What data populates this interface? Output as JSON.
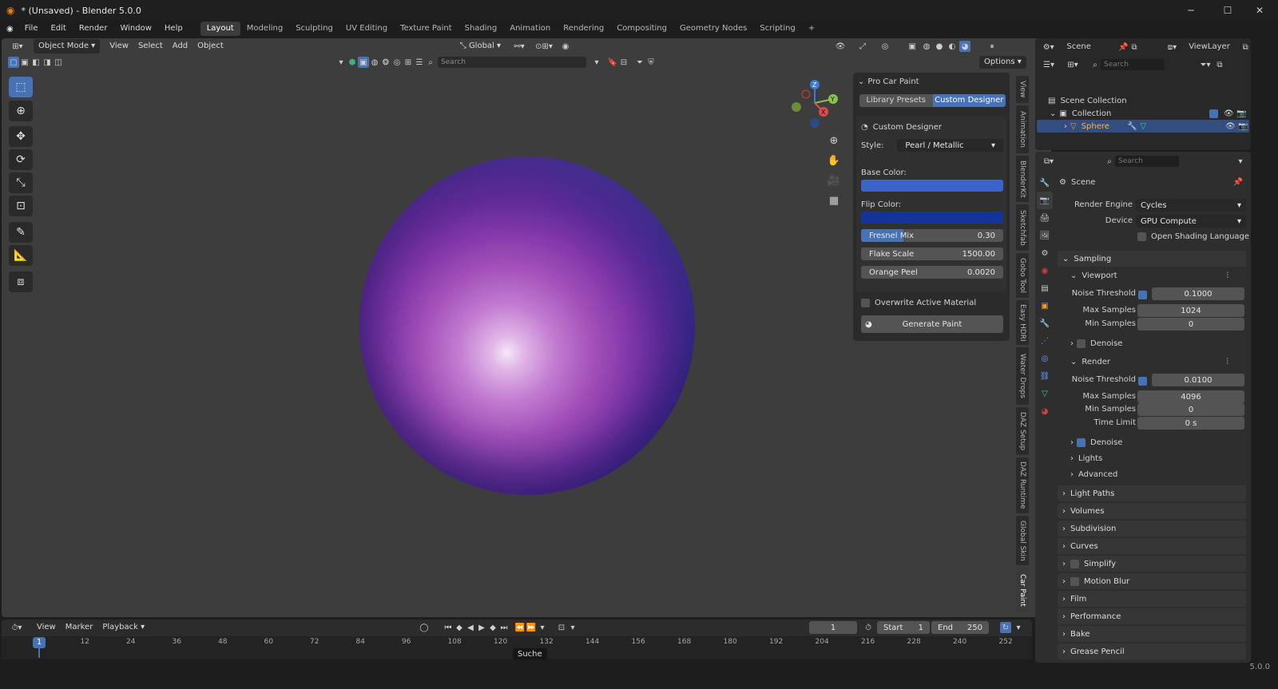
{
  "window": {
    "title": "* (Unsaved) - Blender 5.0.0"
  },
  "menu": [
    "File",
    "Edit",
    "Render",
    "Window",
    "Help"
  ],
  "workspaces": [
    "Layout",
    "Modeling",
    "Sculpting",
    "UV Editing",
    "Texture Paint",
    "Shading",
    "Animation",
    "Rendering",
    "Compositing",
    "Geometry Nodes",
    "Scripting"
  ],
  "viewport": {
    "mode": "Object Mode",
    "menus": [
      "View",
      "Select",
      "Add",
      "Object"
    ],
    "transform_orientation": "Global",
    "search_placeholder": "Search",
    "options": "Options"
  },
  "gizmo": {
    "x": "X",
    "y": "Y",
    "z": "Z"
  },
  "npanel": {
    "header": "Pro Car Paint",
    "tabs": [
      "Library Presets",
      "Custom Designer"
    ],
    "active_tab": "Custom Designer",
    "section": "Custom Designer",
    "style_label": "Style:",
    "style_value": "Pearl / Metallic",
    "base_color_label": "Base Color:",
    "base_color": "#3b63c8",
    "flip_color_label": "Flip Color:",
    "flip_color": "#15349a",
    "fresnel_label": "Fresnel Mix",
    "fresnel_value": "0.30",
    "fresnel_fraction": 0.3,
    "flake_label": "Flake Scale",
    "flake_value": "1500.00",
    "orange_label": "Orange Peel",
    "orange_value": "0.0020",
    "overwrite_label": "Overwrite Active Material",
    "generate_label": "Generate Paint"
  },
  "side_tabs": [
    "View",
    "Animation",
    "BlenderKit",
    "Sketchfab",
    "Gobo Tool",
    "Easy HDRI",
    "Water Drops",
    "DAZ Setup",
    "DAZ Runtime",
    "Global Skin",
    "Car Paint"
  ],
  "timeline": {
    "menus": [
      "View",
      "Marker",
      "Playback"
    ],
    "current_frame": "1",
    "start_label": "Start",
    "start_value": "1",
    "end_label": "End",
    "end_value": "250",
    "ticks": [
      "1",
      "12",
      "24",
      "36",
      "48",
      "60",
      "72",
      "84",
      "96",
      "108",
      "120",
      "132",
      "144",
      "156",
      "168",
      "180",
      "192",
      "204",
      "216",
      "228",
      "240",
      "252"
    ],
    "tooltip": "Suche"
  },
  "outliner": {
    "scene": "Scene",
    "view_layer": "ViewLayer",
    "search_placeholder": "Search",
    "items": [
      "Scene Collection",
      "Collection",
      "Sphere"
    ]
  },
  "properties": {
    "search_placeholder": "Search",
    "scene": "Scene",
    "render_engine_label": "Render Engine",
    "render_engine": "Cycles",
    "device_label": "Device",
    "device": "GPU Compute",
    "osl_label": "Open Shading Language",
    "sampling": "Sampling",
    "viewport": "Viewport",
    "noise_threshold_label": "Noise Threshold",
    "vp_noise": "0.1000",
    "max_samples_label": "Max Samples",
    "vp_max": "1024",
    "min_samples_label": "Min Samples",
    "vp_min": "0",
    "denoise_label": "Denoise",
    "render": "Render",
    "r_noise": "0.0100",
    "r_max": "4096",
    "r_min": "0",
    "time_limit_label": "Time Limit",
    "time_limit": "0 s",
    "lights": "Lights",
    "advanced": "Advanced",
    "sections": [
      "Light Paths",
      "Volumes",
      "Subdivision",
      "Curves",
      "Simplify",
      "Motion Blur",
      "Film",
      "Performance",
      "Bake",
      "Grease Pencil"
    ]
  },
  "status": {
    "version": "5.0.0"
  }
}
